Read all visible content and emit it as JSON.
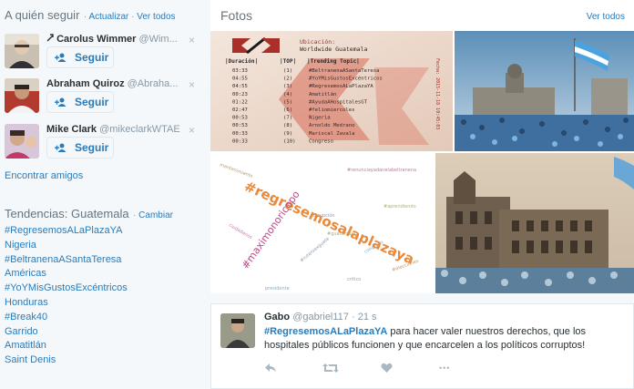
{
  "who_to_follow": {
    "title": "A quién seguir",
    "sep": "·",
    "refresh": "Actualizar",
    "view_all": "Ver todos",
    "close_glyph": "×",
    "follow_label": "Seguir",
    "items": [
      {
        "name": "Carolus Wimmer",
        "handle": "@Wim..."
      },
      {
        "name": "Abraham Quiroz",
        "handle": "@Abraha..."
      },
      {
        "name": "Mike Clark",
        "handle": "@mikeclarkWTAE"
      }
    ],
    "find_friends": "Encontrar amigos"
  },
  "trends": {
    "title": "Tendencias: Guatemala",
    "sep": "·",
    "change": "Cambiar",
    "items": [
      "#RegresemosALaPlazaYA",
      "Nigeria",
      "#BeltranenaASantaTeresa",
      "Américas",
      "#YoYMisGustosExcéntricos",
      "Honduras",
      "#Break40",
      "Garrido",
      "Amatitlán",
      "Saint Denis"
    ]
  },
  "photos": {
    "title": "Fotos",
    "view_all": "Ver todos",
    "table_image": {
      "ubicacion_label": "Ubicación:",
      "ubicacion_value": "Worldwide  Guatemala",
      "col_duracion": "|Duración|",
      "col_top": "|TOP|",
      "col_topic": "|Trending Topic|",
      "fecha": "Fecha: 2015-11-18 10:45:03",
      "rows": [
        {
          "d": "03:33",
          "n": "(1)",
          "t": "#BeltranenaASantaTeresa"
        },
        {
          "d": "04:55",
          "n": "(2)",
          "t": "#YoYMisGustosExcéntricos"
        },
        {
          "d": "04:55",
          "n": "(3)",
          "t": "#RegresemosALaPlazaYA"
        },
        {
          "d": "00:23",
          "n": "(4)",
          "t": "Amatitlán"
        },
        {
          "d": "01:22",
          "n": "(5)",
          "t": "#AyudaAHospitalesGT"
        },
        {
          "d": "02:47",
          "n": "(6)",
          "t": "#feliomiercoles"
        },
        {
          "d": "00:53",
          "n": "(7)",
          "t": "Nigeria"
        },
        {
          "d": "00:53",
          "n": "(8)",
          "t": "Arnoldo Medrano"
        },
        {
          "d": "00:33",
          "n": "(9)",
          "t": "Mariscal Zavala"
        },
        {
          "d": "00:33",
          "n": "(10)",
          "t": "Congreso"
        }
      ]
    },
    "wordcloud_main": "#regresemosalaplazaya",
    "wordcloud_second": "#maximonoricopo",
    "wordcloud_small": [
      "corrupción",
      "#guatemala",
      "#renunciayadanelabeltranena",
      "congreso",
      "mantenimiento",
      "critico",
      "#ruteroaxguate",
      "#aprendiendo",
      "ciudadanos",
      "presidente",
      "#elecciones"
    ]
  },
  "tweet": {
    "name": "Gabo",
    "handle": "@gabriel117",
    "sep": "·",
    "time": "21 s",
    "hashtag": "#RegresemosALaPlazaYA",
    "text": " para hacer valer nuestros derechos, que los hospitales públicos funcionen y que encarcelen a los políticos corruptos!",
    "more_glyph": "•••"
  },
  "colors": {
    "link": "#2b7bb9",
    "muted": "#8899a6",
    "action_icon": "#aab8c2"
  }
}
